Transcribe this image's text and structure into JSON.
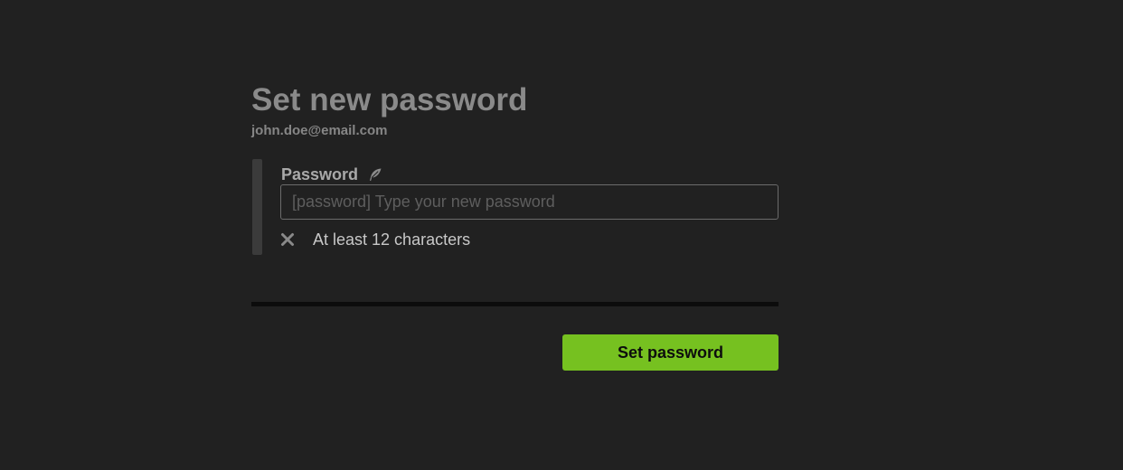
{
  "header": {
    "title": "Set new password",
    "email": "john.doe@email.com"
  },
  "password_field": {
    "label": "Password",
    "label_icon": "feather-icon",
    "placeholder": "[password] Type your new password",
    "value": ""
  },
  "requirements": [
    {
      "icon": "x-icon",
      "status": "unmet",
      "text": "At least 12 characters"
    }
  ],
  "actions": {
    "submit_label": "Set password"
  },
  "colors": {
    "background": "#212121",
    "accent": "#76c120",
    "title": "#8a8a8a",
    "divider": "#0c0c0c"
  }
}
